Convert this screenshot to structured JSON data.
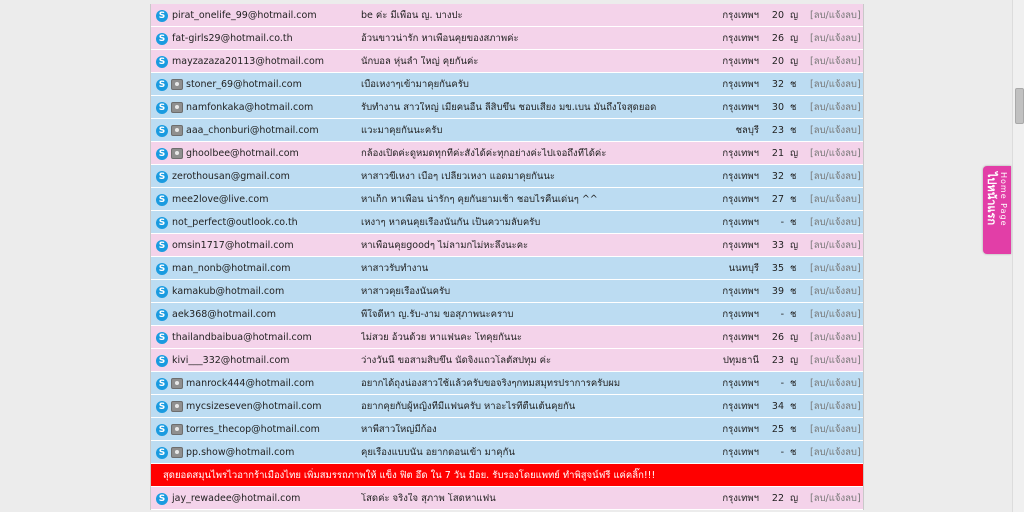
{
  "rows": [
    {
      "email": "pirat_onelife_99@hotmail.com",
      "message": "be ค่ะ มีเพื่อน ญ. บางปะ",
      "province": "กรุงเทพฯ",
      "age": "20",
      "sex": "ญ",
      "action": "[ลบ/แจ้งลบ]",
      "color": "pink",
      "cam": false
    },
    {
      "email": "fat-girls29@hotmail.co.th",
      "message": "อ้วนขาวน่ารัก หาเพื่อนคุยของสภาพค่ะ",
      "province": "กรุงเทพฯ",
      "age": "26",
      "sex": "ญ",
      "action": "[ลบ/แจ้งลบ]",
      "color": "pink",
      "cam": false
    },
    {
      "email": "mayzazaza20113@hotmail.com",
      "message": "นักบอล หุ่นล่ำ ใหญ่ คุยกันค่ะ",
      "province": "กรุงเทพฯ",
      "age": "20",
      "sex": "ญ",
      "action": "[ลบ/แจ้งลบ]",
      "color": "pink",
      "cam": false
    },
    {
      "email": "stoner_69@hotmail.com",
      "message": "เบื่อเหงาๆเข้ามาคุยกันครับ",
      "province": "กรุงเทพฯ",
      "age": "32",
      "sex": "ช",
      "action": "[ลบ/แจ้งลบ]",
      "color": "blue",
      "cam": true
    },
    {
      "email": "namfonkaka@hotmail.com",
      "message": "รับทำงาน สาวใหญ่ เมียคนอื่น ลี่สิบขึ้น ชอบเสียง มข.เบน มันถึงใจสุดยอด",
      "province": "กรุงเทพฯ",
      "age": "30",
      "sex": "ช",
      "action": "[ลบ/แจ้งลบ]",
      "color": "blue",
      "cam": true
    },
    {
      "email": "aaa_chonburi@hotmail.com",
      "message": "แวะมาคุยกันนะครับ",
      "province": "ชลบุรี",
      "age": "23",
      "sex": "ช",
      "action": "[ลบ/แจ้งลบ]",
      "color": "blue",
      "cam": true
    },
    {
      "email": "ghoolbee@hotmail.com",
      "message": "กล้องเปิดค่ะดูหมดทุกที่ค่ะสั่งได้ค่ะทุกอย่างค่ะไปเจอถึงที่ได้ค่ะ",
      "province": "กรุงเทพฯ",
      "age": "21",
      "sex": "ญ",
      "action": "[ลบ/แจ้งลบ]",
      "color": "pink",
      "cam": true
    },
    {
      "email": "zerothousan@gmail.com",
      "message": "หาสาวขี้เหงา เบื่อๆ เปลี่ยวเหงา แอดมาคุยกันนะ",
      "province": "กรุงเทพฯ",
      "age": "32",
      "sex": "ช",
      "action": "[ลบ/แจ้งลบ]",
      "color": "blue",
      "cam": false
    },
    {
      "email": "mee2love@live.com",
      "message": "หาเก็ก หาเพื่อน น่ารักๆ คุยกันยามเช้า ชอบไรคืนเด่นๆ ^^",
      "province": "กรุงเทพฯ",
      "age": "27",
      "sex": "ช",
      "action": "[ลบ/แจ้งลบ]",
      "color": "blue",
      "cam": false
    },
    {
      "email": "not_perfect@outlook.co.th",
      "message": "เหงาๆ หาคนคุยเรื่องนั้นกัน เป็นความลับครับ",
      "province": "กรุงเทพฯ",
      "age": "-",
      "sex": "ช",
      "action": "[ลบ/แจ้งลบ]",
      "color": "blue",
      "cam": false
    },
    {
      "email": "omsin1717@hotmail.com",
      "message": "หาเพื่อนคุยgoodๆ ไม่ลามกไม่หะลึ่งนะคะ",
      "province": "กรุงเทพฯ",
      "age": "33",
      "sex": "ญ",
      "action": "[ลบ/แจ้งลบ]",
      "color": "pink",
      "cam": false
    },
    {
      "email": "man_nonb@hotmail.com",
      "message": "หาสาวรับทำงาน",
      "province": "นนทบุรี",
      "age": "35",
      "sex": "ช",
      "action": "[ลบ/แจ้งลบ]",
      "color": "blue",
      "cam": false
    },
    {
      "email": "kamakub@hotmail.com",
      "message": "หาสาวคุยเรื่องนั้นครับ",
      "province": "กรุงเทพฯ",
      "age": "39",
      "sex": "ช",
      "action": "[ลบ/แจ้งลบ]",
      "color": "blue",
      "cam": false
    },
    {
      "email": "aek368@hotmail.com",
      "message": "พี่ใจดีหา ญ.รับ-งาม ขอสุภาพนะคราบ",
      "province": "กรุงเทพฯ",
      "age": "-",
      "sex": "ช",
      "action": "[ลบ/แจ้งลบ]",
      "color": "blue",
      "cam": false
    },
    {
      "email": "thailandbaibua@hotmail.com",
      "message": "ไม่สวย อ้วนด้วย หาแฟนคะ โทคุยกันนะ",
      "province": "กรุงเทพฯ",
      "age": "26",
      "sex": "ญ",
      "action": "[ลบ/แจ้งลบ]",
      "color": "pink",
      "cam": false
    },
    {
      "email": "kivi___332@hotmail.com",
      "message": "ว่างวันนี้ ขอสามสิบขึ้น นัดจิงแถวโลตัสปทุม ค่ะ",
      "province": "ปทุมธานี",
      "age": "23",
      "sex": "ญ",
      "action": "[ลบ/แจ้งลบ]",
      "color": "pink",
      "cam": false
    },
    {
      "email": "manrock444@hotmail.com",
      "message": "อยากได้ถุงน่องสาวใช้แล้วครับขอจริงๆกทมสมุทรปราการครับผม",
      "province": "กรุงเทพฯ",
      "age": "-",
      "sex": "ช",
      "action": "[ลบ/แจ้งลบ]",
      "color": "blue",
      "cam": true
    },
    {
      "email": "mycsizeseven@hotmail.com",
      "message": "อยากคุยกับผู้หญิงที่มีแฟนครับ หาอะไรที่ตื่นเต้นคุยกัน",
      "province": "กรุงเทพฯ",
      "age": "34",
      "sex": "ช",
      "action": "[ลบ/แจ้งลบ]",
      "color": "blue",
      "cam": true
    },
    {
      "email": "torres_thecop@hotmail.com",
      "message": "หาพี่สาวใหญ่มีก้อง",
      "province": "กรุงเทพฯ",
      "age": "25",
      "sex": "ช",
      "action": "[ลบ/แจ้งลบ]",
      "color": "blue",
      "cam": true
    },
    {
      "email": "pp.show@hotmail.com",
      "message": "คุยเรื่องแบบนั้น อยากดอนเข้า มาคุกัน",
      "province": "กรุงเทพฯ",
      "age": "-",
      "sex": "ช",
      "action": "[ลบ/แจ้งลบ]",
      "color": "blue",
      "cam": true
    }
  ],
  "banner": {
    "text": "สุดยอดสมุนไพรไวอากร้าเมืองไทย เพิ่มสมรรถภาพให้ แข็ง ฟิต อึด ใน 7 วัน มีอย. รับรองโดยแพทย์ ทำพิสูจน์ฟรี แค่คลิ๊ก!!!"
  },
  "last_row": {
    "email": "jay_rewadee@hotmail.com",
    "message": "โสดค่ะ จริงใจ สุภาพ โสดหาแฟน",
    "province": "กรุงเทพฯ",
    "age": "22",
    "sex": "ญ",
    "action": "[ลบ/แจ้งลบ]",
    "color": "pink",
    "cam": false
  },
  "home_tab": {
    "label": "ไปหน้าแรก",
    "sublabel": "Home Page"
  },
  "colors": {
    "pink_row": "#f4d3ea",
    "blue_row": "#bcdcf2",
    "banner": "#ff0000",
    "home_tab": "#e23ea7",
    "skype": "#1a9be0"
  },
  "icons": {
    "skype": "skype-icon",
    "webcam": "webcam-icon"
  }
}
